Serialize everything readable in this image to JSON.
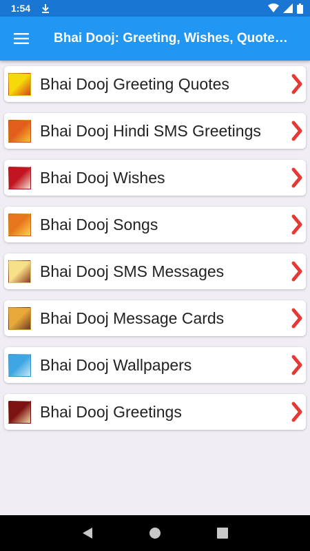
{
  "status_bar": {
    "time": "1:54",
    "icons": [
      "download-icon",
      "wifi-icon",
      "cell-signal-icon",
      "battery-icon"
    ]
  },
  "app_bar": {
    "title": "Bhai Dooj: Greeting, Wishes, Quote…",
    "menu_icon": "hamburger-menu-icon",
    "color": "#2196f3"
  },
  "categories": [
    {
      "label": "Bhai Dooj Greeting Quotes",
      "thumb_colors": [
        "#f5d90a",
        "#d4451f"
      ]
    },
    {
      "label": "Bhai Dooj Hindi SMS Greetings",
      "thumb_colors": [
        "#e35d1c",
        "#f6c233"
      ]
    },
    {
      "label": "Bhai Dooj Wishes",
      "thumb_colors": [
        "#c21521",
        "#f2e4d2"
      ]
    },
    {
      "label": "Bhai Dooj Songs",
      "thumb_colors": [
        "#e8761e",
        "#ffd24c"
      ]
    },
    {
      "label": "Bhai Dooj SMS Messages",
      "thumb_colors": [
        "#f7e08a",
        "#8e3a1c"
      ]
    },
    {
      "label": "Bhai Dooj Message Cards",
      "thumb_colors": [
        "#e9a93a",
        "#6b3c1e"
      ]
    },
    {
      "label": "Bhai Dooj Wallpapers",
      "thumb_colors": [
        "#3da6e3",
        "#c9e7f7"
      ]
    },
    {
      "label": "Bhai Dooj Greetings",
      "thumb_colors": [
        "#7d1212",
        "#f3d8a8"
      ]
    }
  ],
  "chevron_color": "#e53935",
  "nav_bar": {
    "icons": [
      "back-icon",
      "home-icon",
      "recents-icon"
    ]
  }
}
